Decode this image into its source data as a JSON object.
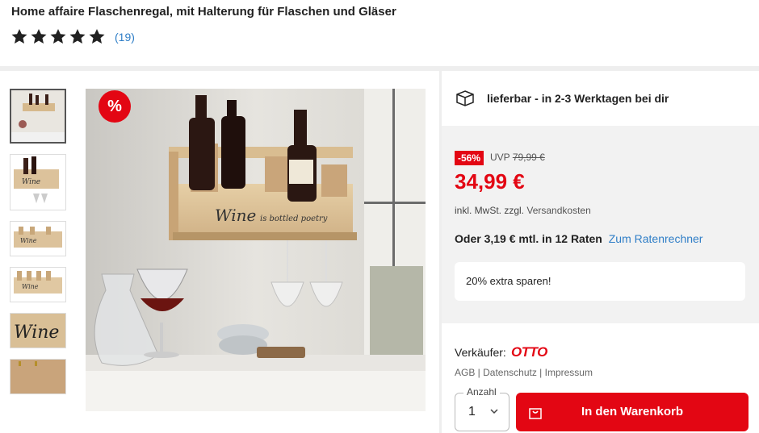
{
  "product": {
    "title": "Home affaire Flaschenregal, mit Halterung für Flaschen und Gläser",
    "rating_stars": 5,
    "review_count": "(19)"
  },
  "gallery": {
    "sale_badge": "%",
    "thumb_label": "Wine"
  },
  "delivery": {
    "icon": "package-icon",
    "text": "lieferbar - in 2-3 Werktagen bei dir"
  },
  "pricing": {
    "discount_badge": "-56%",
    "uvp_label": "UVP",
    "uvp_price": "79,99 €",
    "price": "34,99 €",
    "vat_text": "inkl. MwSt. zzgl.",
    "shipping_link": "Versandkosten",
    "installment_text": "Oder 3,19 € mtl. in 12 Raten",
    "installment_link": "Zum Ratenrechner",
    "extra_savings": "20% extra sparen!"
  },
  "seller": {
    "label": "Verkäufer:",
    "name": "OTTO",
    "legal_links": "AGB | Datenschutz | Impressum"
  },
  "cart": {
    "qty_label": "Anzahl",
    "qty_value": "1",
    "add_button": "In den Warenkorb"
  },
  "colors": {
    "accent": "#e30613",
    "link": "#2f7ec7",
    "panel": "#f2f2f2"
  }
}
